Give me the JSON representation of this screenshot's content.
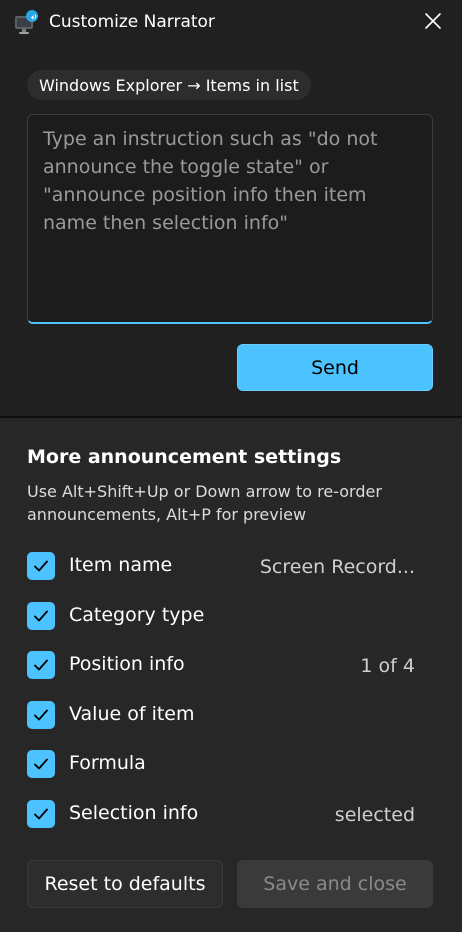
{
  "window": {
    "title": "Customize Narrator",
    "icon": "narrator-app-icon",
    "close_icon": "close-icon"
  },
  "context": {
    "label": "Windows Explorer → Items in list"
  },
  "instruction": {
    "placeholder": "Type an instruction such as \"do not announce the toggle state\" or \"announce position info then item name then selection info\"",
    "value": ""
  },
  "send_label": "Send",
  "section": {
    "title": "More announcement settings",
    "hint": "Use Alt+Shift+Up or Down arrow to re-order announcements, Alt+P for preview"
  },
  "settings": [
    {
      "label": "Item name",
      "checked": true,
      "value": "Screen Record..."
    },
    {
      "label": "Category type",
      "checked": true,
      "value": ""
    },
    {
      "label": "Position info",
      "checked": true,
      "value": "1 of 4"
    },
    {
      "label": "Value of item",
      "checked": true,
      "value": ""
    },
    {
      "label": "Formula",
      "checked": true,
      "value": ""
    },
    {
      "label": "Selection info",
      "checked": true,
      "value": "selected"
    }
  ],
  "footer": {
    "reset_label": "Reset to defaults",
    "save_label": "Save and close"
  },
  "colors": {
    "accent": "#4cc2ff",
    "background": "#272727",
    "panel": "#202020"
  }
}
